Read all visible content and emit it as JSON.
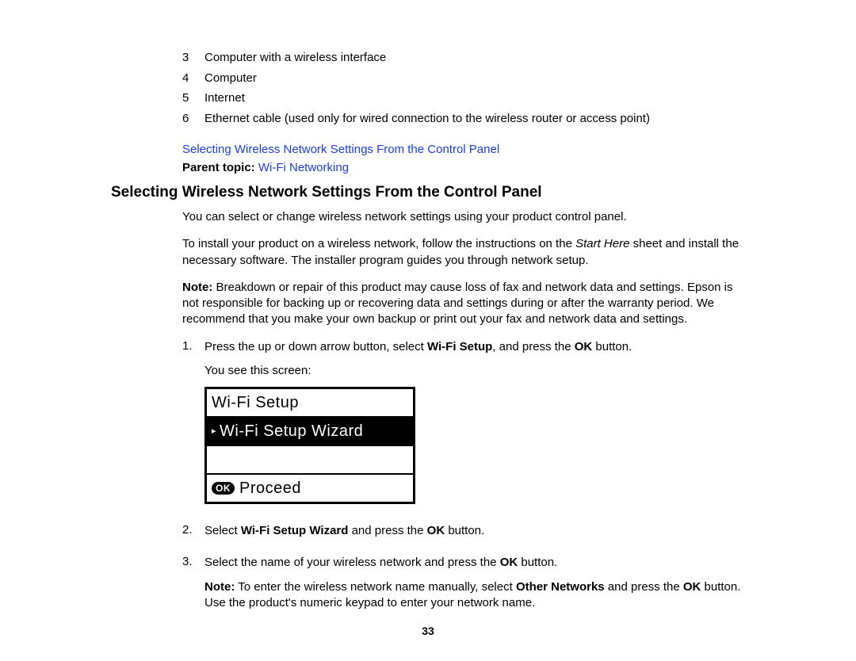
{
  "definitions": [
    {
      "num": "3",
      "text": "Computer with a wireless interface"
    },
    {
      "num": "4",
      "text": "Computer"
    },
    {
      "num": "5",
      "text": "Internet"
    },
    {
      "num": "6",
      "text": "Ethernet cable (used only for wired connection to the wireless router or access point)"
    }
  ],
  "topic_link": "Selecting Wireless Network Settings From the Control Panel",
  "parent_topic_label": "Parent topic:",
  "parent_topic_link": "Wi-Fi Networking",
  "heading": "Selecting Wireless Network Settings From the Control Panel",
  "intro1": "You can select or change wireless network settings using your product control panel.",
  "intro2_pre": "To install your product on a wireless network, follow the instructions on the ",
  "intro2_em": "Start Here",
  "intro2_post": " sheet and install the necessary software. The installer program guides you through network setup.",
  "note1_label": "Note:",
  "note1_text": " Breakdown or repair of this product may cause loss of fax and network data and settings. Epson is not responsible for backing up or recovering data and settings during or after the warranty period. We recommend that you make your own backup or print out your fax and network data and settings.",
  "steps": {
    "s1": {
      "num": "1.",
      "text_pre": "Press the up or down arrow button, select ",
      "text_b1": "Wi-Fi Setup",
      "text_mid": ", and press the ",
      "text_b2": "OK",
      "text_post": " button.",
      "screen_lead": "You see this screen:"
    },
    "s2": {
      "num": "2.",
      "pre": "Select ",
      "b1": "Wi-Fi Setup Wizard",
      "mid": " and press the ",
      "b2": "OK",
      "post": " button."
    },
    "s3": {
      "num": "3.",
      "pre": "Select the name of your wireless network and press the ",
      "b1": "OK",
      "post": " button.",
      "note_label": "Note:",
      "note_pre": " To enter the wireless network name manually, select ",
      "note_b1": "Other Networks",
      "note_mid": " and press the ",
      "note_b2": "OK",
      "note_post": " button. Use the product's numeric keypad to enter your network name."
    }
  },
  "lcd": {
    "title": "Wi-Fi Setup",
    "selected": "Wi-Fi Setup Wizard",
    "ok_label": "OK",
    "proceed": "Proceed"
  },
  "page_number": "33"
}
